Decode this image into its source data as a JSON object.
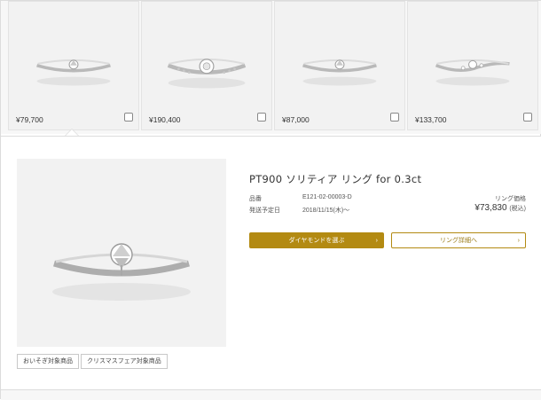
{
  "grid": {
    "items": [
      {
        "price": "¥79,700",
        "ring": "solitaire-ring"
      },
      {
        "price": "¥190,400",
        "ring": "halo-eternity-ring"
      },
      {
        "price": "¥87,000",
        "ring": "solitaire-ring"
      },
      {
        "price": "¥133,700",
        "ring": "twist-side-stone-ring"
      }
    ]
  },
  "detail": {
    "title": "PT900 ソリティア リング for 0.3ct",
    "product_no_label": "品番",
    "product_no": "E121-02-00003-D",
    "ship_label": "発送予定日",
    "ship_date": "2018/11/15(木)〜",
    "price_label": "リング価格",
    "price": "¥73,830",
    "tax_note": "(税込)",
    "choose_diamond": "ダイヤモンドを選ぶ",
    "ring_details": "リング詳細へ",
    "arrow": "›",
    "tags": [
      "おいそぎ対象商品",
      "クリスマスフェア対象商品"
    ]
  },
  "colors": {
    "gold": "#b38a12",
    "card_bg": "#f2f2f2"
  }
}
